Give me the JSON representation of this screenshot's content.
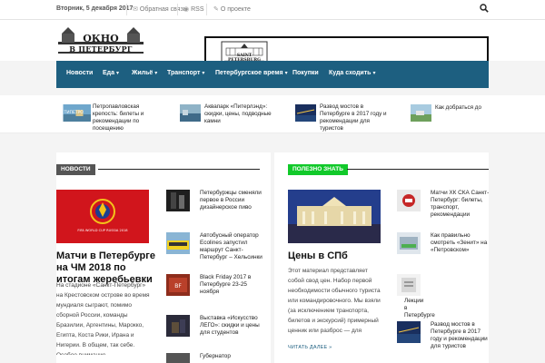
{
  "topbar": {
    "date": "Вторник, 5 декабря 2017",
    "feedback": "Обратная связь",
    "rss": "RSS",
    "about": "О проекте"
  },
  "logo": {
    "line1": "ОКНО",
    "line2": "В ПЕТЕРБУРГ"
  },
  "banner": {
    "text": "SAINT PETERSBURG"
  },
  "nav": [
    {
      "label": "Новости",
      "caret": false
    },
    {
      "label": "Еда",
      "caret": true
    },
    {
      "label": "Жильё",
      "caret": true
    },
    {
      "label": "Транспорт",
      "caret": true
    },
    {
      "label": "Петербургское время",
      "caret": true
    },
    {
      "label": "Покупки",
      "caret": false
    },
    {
      "label": "Куда сходить",
      "caret": true
    }
  ],
  "ticker": [
    {
      "title": "Петропавловская крепость: билеты и рекомендации по посещению"
    },
    {
      "title": "Аквапарк «Питерлэнд»: скидки, цены, подводные камни"
    },
    {
      "title": "Развод мостов в Петербурге в 2017 году и рекомендации для туристов"
    },
    {
      "title": "Как добраться до"
    }
  ],
  "news": {
    "tag": "НОВОСТИ",
    "featured": {
      "img_text": "FIFA WORLD CUP RUSSIA 2018",
      "title": "Матчи в Петербурге на ЧМ 2018 по итогам жеребьевки",
      "excerpt": "На стадионе «Санкт-Петербург» на Крестовском острове во время мундиаля сыграют, помимо сборной России, команды Бразилии, Аргентины, Марокко, Египта, Коста Рики, Ирана и Нигерии. В общем, так себе. Особое внимание,..."
    },
    "items": [
      {
        "title": "Петербуржцы сменяли первое в России дизайнерское пиво"
      },
      {
        "title": "Автобусный оператор Ecolines запустил маршрут Санкт-Петербург – Хельсинки"
      },
      {
        "title": "Black Friday 2017 в Петербурге 23-25 ноября"
      },
      {
        "title": "Выставка «Искусство ЛЕГО»: скидки и цены для студентов"
      },
      {
        "title": "Губернатор"
      }
    ]
  },
  "useful": {
    "tag": "ПОЛЕЗНО ЗНАТЬ",
    "featured": {
      "title": "Цены в СПб",
      "excerpt": "Этот материал представляет собой свод цен. Набор первой необходимости обычного туриста или командировочного. Мы взяли (за исключением транспорта, билетов и экскурсий) примерный ценник или разброс — для вашего ...",
      "read_more": "ЧИТАТЬ ДАЛЕЕ »"
    },
    "items": [
      {
        "title": "Матчи ХК СКА Санкт-Петербург: билеты, транспорт, рекомендации"
      },
      {
        "title": "Как правильно смотреть «Зенит» на «Петровском»"
      },
      {
        "title": "Лекции в Петербурге"
      },
      {
        "title": "Развод мостов в Петербурге в 2017 году и рекомендации для туристов"
      }
    ]
  }
}
